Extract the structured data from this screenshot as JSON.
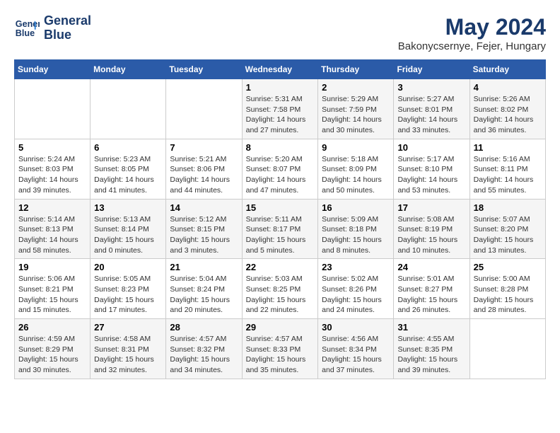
{
  "header": {
    "logo_line1": "General",
    "logo_line2": "Blue",
    "month": "May 2024",
    "location": "Bakonycsernye, Fejer, Hungary"
  },
  "weekdays": [
    "Sunday",
    "Monday",
    "Tuesday",
    "Wednesday",
    "Thursday",
    "Friday",
    "Saturday"
  ],
  "weeks": [
    [
      {
        "day": "",
        "info": ""
      },
      {
        "day": "",
        "info": ""
      },
      {
        "day": "",
        "info": ""
      },
      {
        "day": "1",
        "info": "Sunrise: 5:31 AM\nSunset: 7:58 PM\nDaylight: 14 hours\nand 27 minutes."
      },
      {
        "day": "2",
        "info": "Sunrise: 5:29 AM\nSunset: 7:59 PM\nDaylight: 14 hours\nand 30 minutes."
      },
      {
        "day": "3",
        "info": "Sunrise: 5:27 AM\nSunset: 8:01 PM\nDaylight: 14 hours\nand 33 minutes."
      },
      {
        "day": "4",
        "info": "Sunrise: 5:26 AM\nSunset: 8:02 PM\nDaylight: 14 hours\nand 36 minutes."
      }
    ],
    [
      {
        "day": "5",
        "info": "Sunrise: 5:24 AM\nSunset: 8:03 PM\nDaylight: 14 hours\nand 39 minutes."
      },
      {
        "day": "6",
        "info": "Sunrise: 5:23 AM\nSunset: 8:05 PM\nDaylight: 14 hours\nand 41 minutes."
      },
      {
        "day": "7",
        "info": "Sunrise: 5:21 AM\nSunset: 8:06 PM\nDaylight: 14 hours\nand 44 minutes."
      },
      {
        "day": "8",
        "info": "Sunrise: 5:20 AM\nSunset: 8:07 PM\nDaylight: 14 hours\nand 47 minutes."
      },
      {
        "day": "9",
        "info": "Sunrise: 5:18 AM\nSunset: 8:09 PM\nDaylight: 14 hours\nand 50 minutes."
      },
      {
        "day": "10",
        "info": "Sunrise: 5:17 AM\nSunset: 8:10 PM\nDaylight: 14 hours\nand 53 minutes."
      },
      {
        "day": "11",
        "info": "Sunrise: 5:16 AM\nSunset: 8:11 PM\nDaylight: 14 hours\nand 55 minutes."
      }
    ],
    [
      {
        "day": "12",
        "info": "Sunrise: 5:14 AM\nSunset: 8:13 PM\nDaylight: 14 hours\nand 58 minutes."
      },
      {
        "day": "13",
        "info": "Sunrise: 5:13 AM\nSunset: 8:14 PM\nDaylight: 15 hours\nand 0 minutes."
      },
      {
        "day": "14",
        "info": "Sunrise: 5:12 AM\nSunset: 8:15 PM\nDaylight: 15 hours\nand 3 minutes."
      },
      {
        "day": "15",
        "info": "Sunrise: 5:11 AM\nSunset: 8:17 PM\nDaylight: 15 hours\nand 5 minutes."
      },
      {
        "day": "16",
        "info": "Sunrise: 5:09 AM\nSunset: 8:18 PM\nDaylight: 15 hours\nand 8 minutes."
      },
      {
        "day": "17",
        "info": "Sunrise: 5:08 AM\nSunset: 8:19 PM\nDaylight: 15 hours\nand 10 minutes."
      },
      {
        "day": "18",
        "info": "Sunrise: 5:07 AM\nSunset: 8:20 PM\nDaylight: 15 hours\nand 13 minutes."
      }
    ],
    [
      {
        "day": "19",
        "info": "Sunrise: 5:06 AM\nSunset: 8:21 PM\nDaylight: 15 hours\nand 15 minutes."
      },
      {
        "day": "20",
        "info": "Sunrise: 5:05 AM\nSunset: 8:23 PM\nDaylight: 15 hours\nand 17 minutes."
      },
      {
        "day": "21",
        "info": "Sunrise: 5:04 AM\nSunset: 8:24 PM\nDaylight: 15 hours\nand 20 minutes."
      },
      {
        "day": "22",
        "info": "Sunrise: 5:03 AM\nSunset: 8:25 PM\nDaylight: 15 hours\nand 22 minutes."
      },
      {
        "day": "23",
        "info": "Sunrise: 5:02 AM\nSunset: 8:26 PM\nDaylight: 15 hours\nand 24 minutes."
      },
      {
        "day": "24",
        "info": "Sunrise: 5:01 AM\nSunset: 8:27 PM\nDaylight: 15 hours\nand 26 minutes."
      },
      {
        "day": "25",
        "info": "Sunrise: 5:00 AM\nSunset: 8:28 PM\nDaylight: 15 hours\nand 28 minutes."
      }
    ],
    [
      {
        "day": "26",
        "info": "Sunrise: 4:59 AM\nSunset: 8:29 PM\nDaylight: 15 hours\nand 30 minutes."
      },
      {
        "day": "27",
        "info": "Sunrise: 4:58 AM\nSunset: 8:31 PM\nDaylight: 15 hours\nand 32 minutes."
      },
      {
        "day": "28",
        "info": "Sunrise: 4:57 AM\nSunset: 8:32 PM\nDaylight: 15 hours\nand 34 minutes."
      },
      {
        "day": "29",
        "info": "Sunrise: 4:57 AM\nSunset: 8:33 PM\nDaylight: 15 hours\nand 35 minutes."
      },
      {
        "day": "30",
        "info": "Sunrise: 4:56 AM\nSunset: 8:34 PM\nDaylight: 15 hours\nand 37 minutes."
      },
      {
        "day": "31",
        "info": "Sunrise: 4:55 AM\nSunset: 8:35 PM\nDaylight: 15 hours\nand 39 minutes."
      },
      {
        "day": "",
        "info": ""
      }
    ]
  ]
}
